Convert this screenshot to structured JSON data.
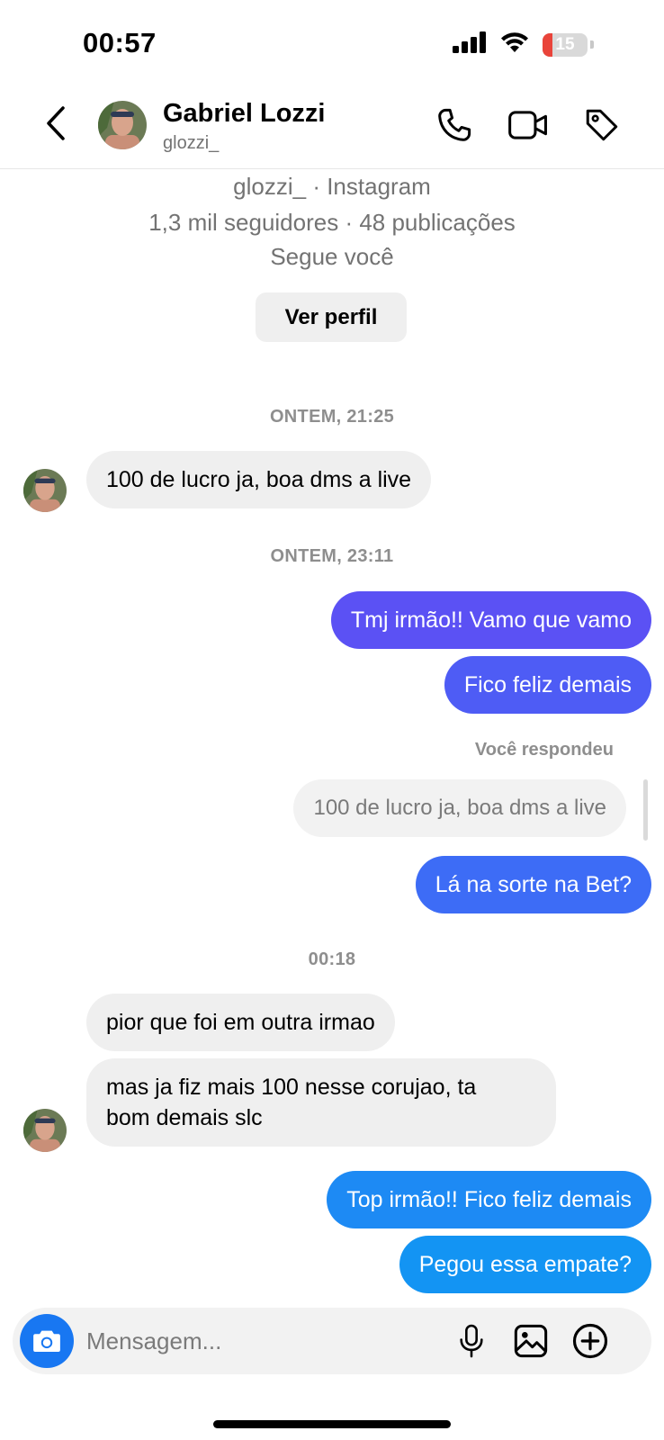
{
  "status_bar": {
    "time": "00:57",
    "battery": "15",
    "icons": [
      "signal-icon",
      "wifi-icon",
      "battery-icon"
    ]
  },
  "header": {
    "name": "Gabriel Lozzi",
    "username": "glozzi_",
    "icons": [
      "back-icon",
      "phone-icon",
      "video-camera-icon",
      "tag-icon"
    ]
  },
  "profile": {
    "line1": "glozzi_ · Instagram",
    "line2": "1,3 mil seguidores · 48 publicações",
    "line3": "Segue você",
    "button": "Ver perfil"
  },
  "conversation": {
    "timestamps": [
      "ONTEM, 21:25",
      "ONTEM, 23:11",
      "00:18"
    ],
    "messages": [
      {
        "from": "them",
        "text": "100 de lucro ja, boa dms a live"
      },
      {
        "from": "me",
        "text": "Tmj irmão!! Vamo que vamo"
      },
      {
        "from": "me",
        "text": "Fico feliz demais"
      },
      {
        "from": "me",
        "text": "Lá na sorte na Bet?"
      },
      {
        "from": "them",
        "text": "pior que foi em outra irmao"
      },
      {
        "from": "them",
        "text_line1": "mas ja fiz mais 100 nesse corujao, ta",
        "text_line2": "bom demais slc"
      },
      {
        "from": "me",
        "text": "Top irmão!! Fico feliz demais"
      },
      {
        "from": "me",
        "text": "Pegou essa empate?"
      }
    ],
    "reply": {
      "label": "Você respondeu",
      "quoted": "100 de lucro ja, boa dms a live"
    }
  },
  "composer": {
    "placeholder": "Mensagem...",
    "icons": [
      "camera-icon",
      "microphone-icon",
      "image-icon",
      "plus-circle-icon"
    ]
  },
  "colors": {
    "out_bubble_1": "#5b51f4",
    "out_bubble_2": "#4e5cf5",
    "out_bubble_3": "#3d6cf6",
    "out_bubble_4": "#1d8af4",
    "out_bubble_5": "#1394f3",
    "in_bubble": "#efefef",
    "camera": "#1877f2",
    "battery_low": "#e9443a"
  }
}
